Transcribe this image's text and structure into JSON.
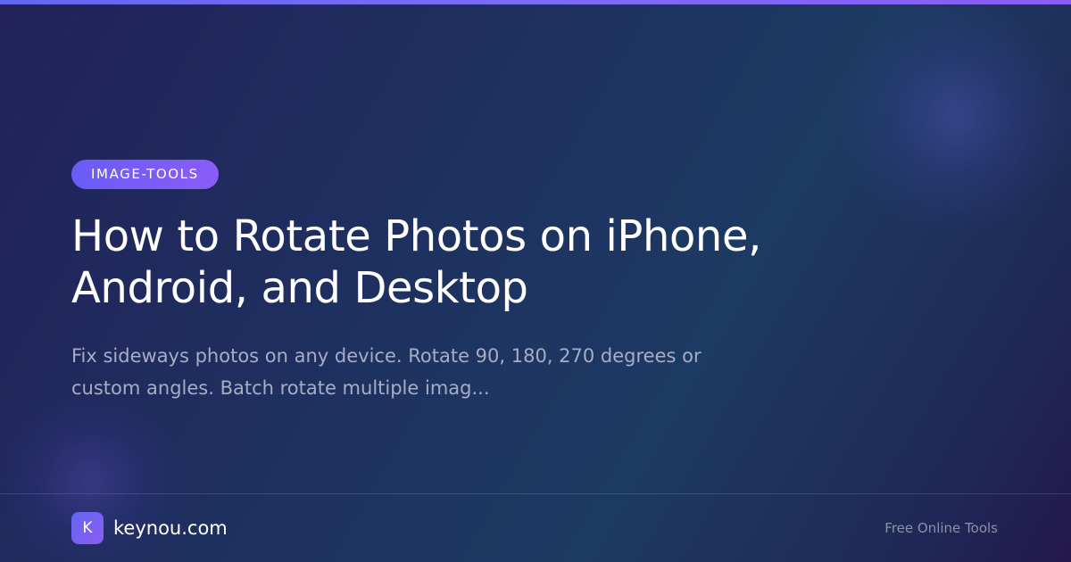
{
  "tag": {
    "label": "IMAGE-TOOLS"
  },
  "title": "How to Rotate Photos on iPhone, Android, and Desktop",
  "subtitle": "Fix sideways photos on any device. Rotate 90, 180, 270 degrees or custom angles. Batch rotate multiple imag...",
  "footer": {
    "logo_letter": "K",
    "brand": "keynou.com",
    "tagline": "Free Online Tools"
  },
  "colors": {
    "accent": "#6366f1",
    "accent_end": "#8b5cf6",
    "title_text": "#ffffff",
    "subtitle_text": "#a6adc4",
    "tagline_text": "#8a92ab"
  }
}
